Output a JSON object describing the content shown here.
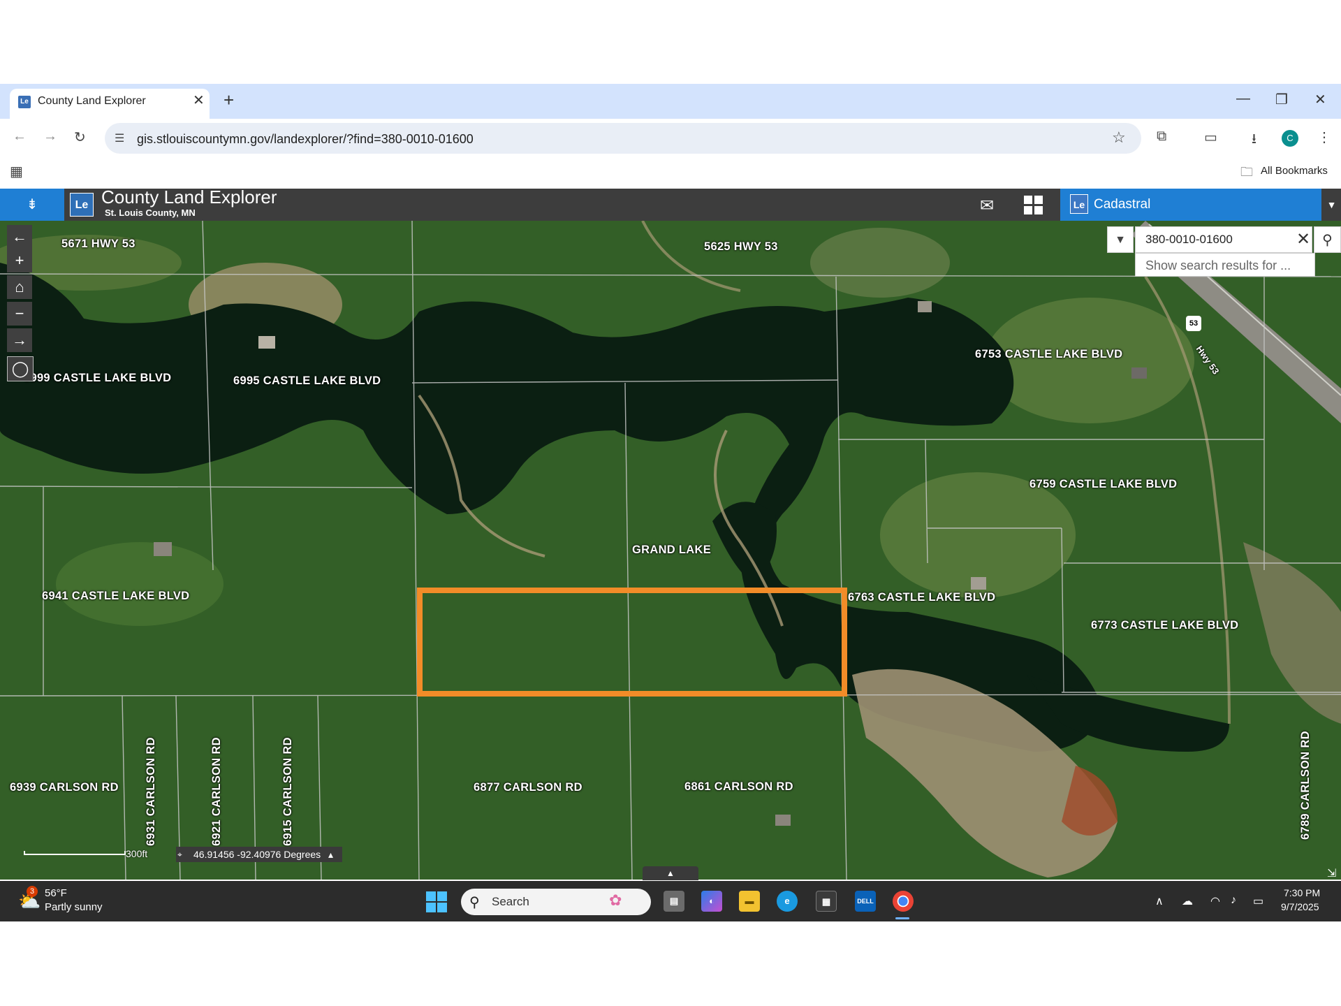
{
  "browser": {
    "tab_title": "County Land Explorer",
    "favicon_text": "Le",
    "url": "gis.stlouiscountymn.gov/landexplorer/?find=380-0010-01600",
    "bookmarks_label": "All Bookmarks",
    "profile_initial": "C"
  },
  "app": {
    "logo_text": "Le",
    "title": "County Land Explorer",
    "subtitle": "St. Louis County, MN",
    "layer_name": "Cadastral"
  },
  "search": {
    "value": "380-0010-01600",
    "suggestion": "Show search results for ..."
  },
  "map": {
    "labels": [
      "5671 HWY 53",
      "5625 HWY 53",
      "6999 CASTLE LAKE BLVD",
      "6995 CASTLE LAKE BLVD",
      "6753 CASTLE LAKE BLVD",
      "6759 CASTLE LAKE BLVD",
      "GRAND LAKE",
      "6941 CASTLE LAKE BLVD",
      "6763 CASTLE LAKE BLVD",
      "6773 CASTLE LAKE BLVD",
      "6939 CARLSON RD",
      "6877 CARLSON RD",
      "6861 CARLSON RD"
    ],
    "vertical_labels": [
      "6931 CARLSON RD",
      "6921 CARLSON RD",
      "6915 CARLSON RD",
      "6789 CARLSON RD"
    ],
    "road_label": "Hwy 53",
    "shield": "53",
    "highlight_color": "#f28c28",
    "scale_label": "300ft",
    "coordinates": "46.91456 -92.40976 Degrees"
  },
  "taskbar": {
    "weather_temp": "56°F",
    "weather_desc": "Partly sunny",
    "weather_badge": "3",
    "search_placeholder": "Search",
    "time": "7:30 PM",
    "date": "9/7/2025"
  }
}
